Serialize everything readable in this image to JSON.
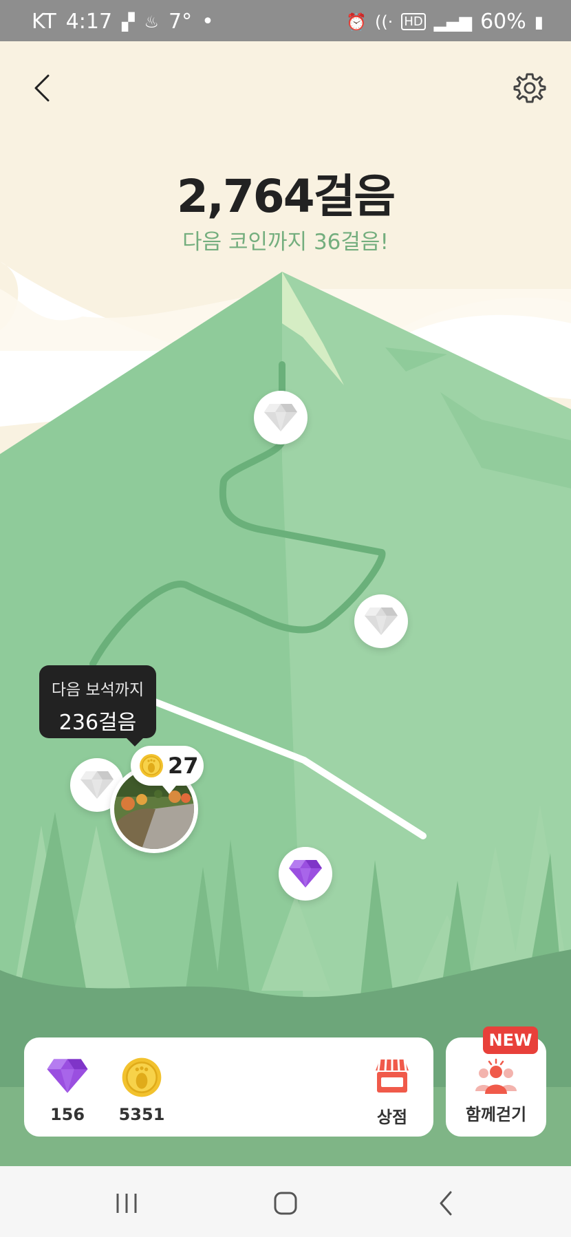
{
  "status_bar": {
    "carrier": "KT",
    "time": "4:17",
    "temperature": "7°",
    "battery": "60%"
  },
  "header": {
    "steps": "2,764걸음",
    "next_coin": "다음 코인까지 36걸음!"
  },
  "map": {
    "tooltip_line1": "다음 보석까지",
    "tooltip_line2": "236걸음",
    "coin_count": "27"
  },
  "bottom": {
    "gems": "156",
    "coins": "5351",
    "shop_label": "상점",
    "walk_together_label": "함께걷기",
    "new_badge": "NEW"
  },
  "colors": {
    "background": "#f9f2e1",
    "mountain": "#8fcb9a",
    "steps_text": "#222222",
    "next_coin_text": "#74ae7e",
    "gem_purple": "#9a4fe0",
    "coin_gold": "#f2c22e",
    "badge_red": "#e8403a"
  },
  "icons": [
    "back-arrow-icon",
    "settings-gear-icon",
    "diamond-icon",
    "coin-footprint-icon",
    "shop-icon",
    "walk-together-icon"
  ]
}
